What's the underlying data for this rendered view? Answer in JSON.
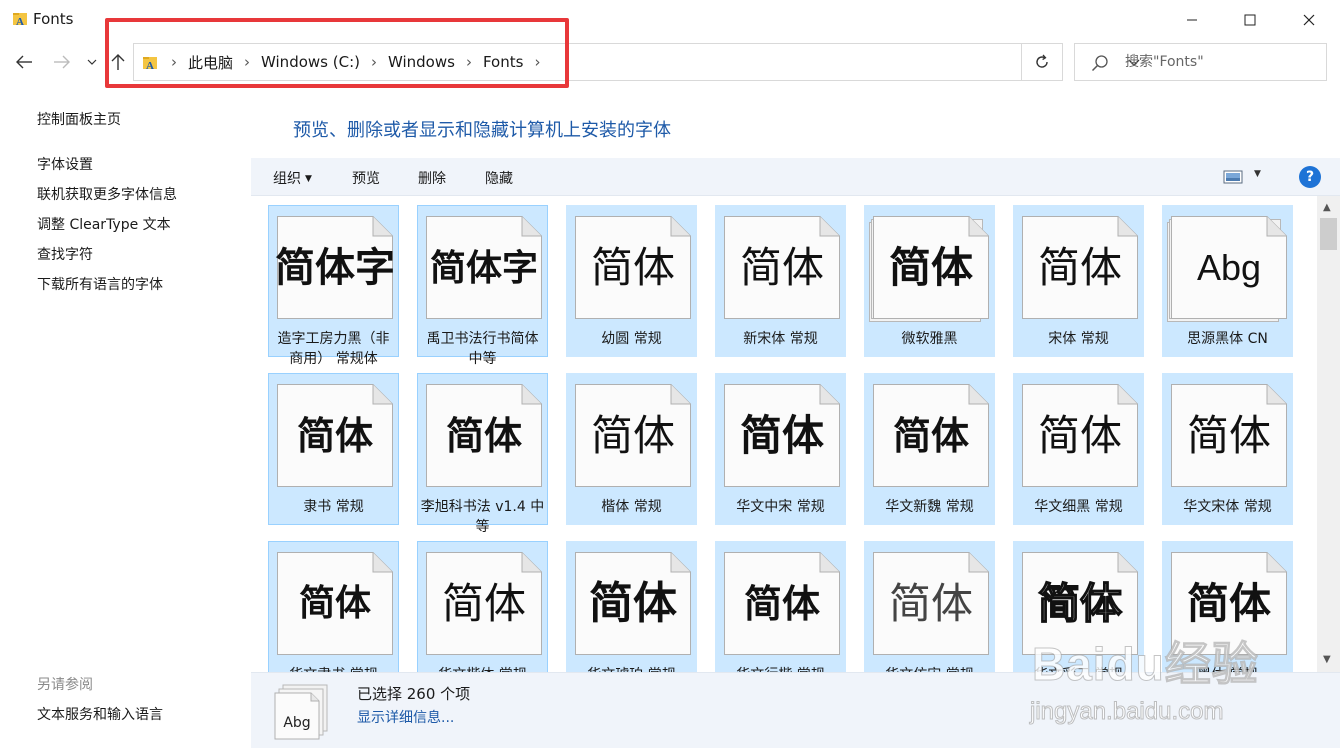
{
  "window": {
    "title": "Fonts"
  },
  "address": {
    "crumbs": [
      "此电脑",
      "Windows (C:)",
      "Windows",
      "Fonts"
    ]
  },
  "search": {
    "placeholder": "搜索\"Fonts\""
  },
  "sidebar": {
    "links": [
      "控制面板主页",
      "字体设置",
      "联机获取更多字体信息",
      "调整 ClearType 文本",
      "查找字符",
      "下载所有语言的字体"
    ],
    "see_also_title": "另请参阅",
    "see_also_links": [
      "文本服务和输入语言"
    ]
  },
  "main": {
    "heading": "预览、删除或者显示和隐藏计算机上安装的字体"
  },
  "commandbar": {
    "organize": "组织",
    "preview": "预览",
    "delete": "删除",
    "hide": "隐藏",
    "help": "?"
  },
  "fonts": [
    {
      "sample": "简体字",
      "label": "造字工房力黑（非商用） 常规体",
      "stack": false
    },
    {
      "sample": "简体字",
      "label": "禹卫书法行书简体 中等",
      "stack": false
    },
    {
      "sample": "简体",
      "label": "幼圆 常规",
      "stack": false
    },
    {
      "sample": "简体",
      "label": "新宋体 常规",
      "stack": false
    },
    {
      "sample": "简体",
      "label": "微软雅黑",
      "stack": true
    },
    {
      "sample": "简体",
      "label": "宋体 常规",
      "stack": false
    },
    {
      "sample": "Abg",
      "label": "思源黑体 CN",
      "stack": true
    },
    {
      "sample": "简体",
      "label": "隶书 常规",
      "stack": false
    },
    {
      "sample": "简体",
      "label": "李旭科书法 v1.4 中等",
      "stack": false
    },
    {
      "sample": "简体",
      "label": "楷体 常规",
      "stack": false
    },
    {
      "sample": "简体",
      "label": "华文中宋 常规",
      "stack": false
    },
    {
      "sample": "简体",
      "label": "华文新魏 常规",
      "stack": false
    },
    {
      "sample": "简体",
      "label": "华文细黑 常规",
      "stack": false
    },
    {
      "sample": "简体",
      "label": "华文宋体 常规",
      "stack": false
    },
    {
      "sample": "简体",
      "label": "华文隶书 常规",
      "stack": false
    },
    {
      "sample": "简体",
      "label": "华文楷体 常规",
      "stack": false
    },
    {
      "sample": "简体",
      "label": "华文琥珀 常规",
      "stack": false
    },
    {
      "sample": "简体",
      "label": "华文行楷 常规",
      "stack": false
    },
    {
      "sample": "简体",
      "label": "华文仿宋 常规",
      "stack": false
    },
    {
      "sample": "简体",
      "label": "华文彩云 常规",
      "stack": false
    },
    {
      "sample": "简体",
      "label": "黑体 常规",
      "stack": false
    }
  ],
  "details": {
    "count": "已选择 260 个项",
    "link": "显示详细信息...",
    "icon_sample": "Abg"
  },
  "watermark": {
    "main": "Baidu经验",
    "sub": "jingyan.baidu.com"
  },
  "colors": {
    "accent": "#1e5aa8",
    "selection": "#cce8ff",
    "highlight": "#e8383a"
  }
}
